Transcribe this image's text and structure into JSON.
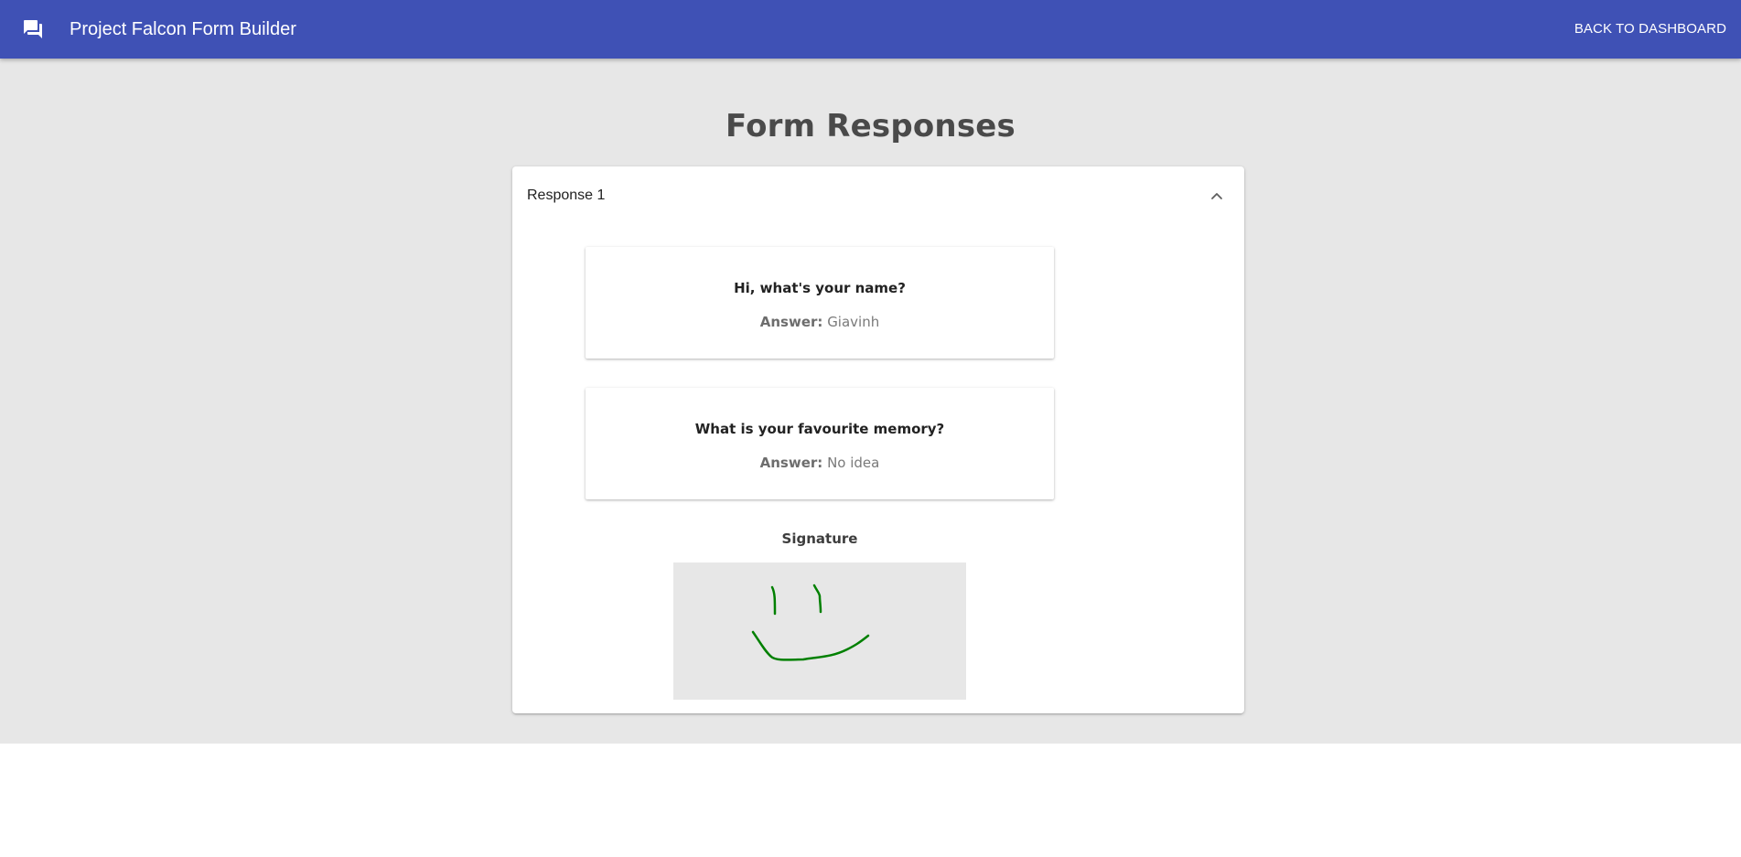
{
  "appbar": {
    "icon": "forum-icon",
    "title": "Project Falcon Form Builder",
    "back_label": "BACK TO DASHBOARD",
    "color": "#3f51b5"
  },
  "page": {
    "title": "Form Responses",
    "background": "#e7e7e7"
  },
  "responses": [
    {
      "header": "Response 1",
      "expanded": true,
      "toggle_icon": "chevron-up-icon",
      "answers": [
        {
          "question": "Hi, what's your name?",
          "answer_label": "Answer:",
          "answer": "Giavinh"
        },
        {
          "question": "What is your favourite memory?",
          "answer_label": "Answer:",
          "answer": "No idea"
        }
      ],
      "signature": {
        "label": "Signature",
        "ink_color": "#008000"
      }
    }
  ]
}
